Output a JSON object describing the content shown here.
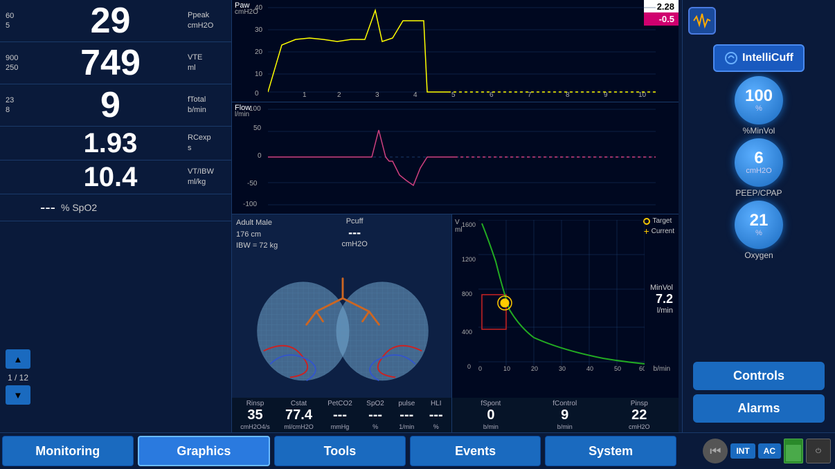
{
  "vitals": [
    {
      "id": "ppeak",
      "limits_high": "60",
      "limits_low": "5",
      "value": "29",
      "unit_line1": "Ppeak",
      "unit_line2": "cmH2O",
      "size": "large"
    },
    {
      "id": "vte",
      "limits_high": "900",
      "limits_low": "250",
      "value": "749",
      "unit_line1": "VTE",
      "unit_line2": "ml",
      "size": "large"
    },
    {
      "id": "ftotal",
      "limits_high": "23",
      "limits_low": "8",
      "value": "9",
      "unit_line1": "fTotal",
      "unit_line2": "b/min",
      "size": "large"
    },
    {
      "id": "rcexp",
      "limits_high": "",
      "limits_low": "",
      "value": "1.93",
      "unit_line1": "RCexp",
      "unit_line2": "s",
      "size": "medium"
    },
    {
      "id": "vtibw",
      "limits_high": "",
      "limits_low": "",
      "value": "10.4",
      "unit_line1": "VT/IBW",
      "unit_line2": "ml/kg",
      "size": "medium"
    }
  ],
  "spo2": {
    "value": "---",
    "label": "% SpO2"
  },
  "page_nav": {
    "current": "1",
    "total": "12"
  },
  "charts": {
    "paw": {
      "label": "Paw",
      "unit": "cmH2O",
      "current_value": "2.28",
      "second_value": "-0.5",
      "y_max": 40,
      "y_mid": 20,
      "y_zero": 0,
      "x_labels": [
        "1",
        "2",
        "3",
        "4",
        "5",
        "6",
        "7",
        "8",
        "9",
        "10"
      ]
    },
    "flow": {
      "label": "Flow",
      "unit": "l/min",
      "y_labels": [
        "100",
        "50",
        "0",
        "-50",
        "-100"
      ]
    }
  },
  "lung_panel": {
    "patient": "Adult Male",
    "height": "176 cm",
    "ibw": "IBW = 72 kg",
    "pcuff_label": "Pcuff",
    "pcuff_value": "---",
    "pcuff_unit": "cmH2O"
  },
  "scatter_panel": {
    "legend_target": "Target",
    "legend_current": "Current",
    "minvol_label": "MinVol",
    "minvol_value": "7.2",
    "minvol_unit": "l/min",
    "y_label": "V\nml",
    "y_ticks": [
      "1600",
      "1200",
      "800",
      "400",
      "0"
    ],
    "x_label": "b/min",
    "x_ticks": [
      "0",
      "10",
      "20",
      "30",
      "40",
      "50",
      "60"
    ],
    "stats": [
      {
        "label": "fSpont",
        "value": "0",
        "unit": "b/min"
      },
      {
        "label": "fControl",
        "value": "9",
        "unit": "b/min"
      },
      {
        "label": "Pinsp",
        "value": "22",
        "unit": "cmH2O"
      }
    ]
  },
  "bottom_stats": [
    {
      "label": "Rinsp",
      "value": "35",
      "unit": "cmH2O4/s"
    },
    {
      "label": "Cstat",
      "value": "77.4",
      "unit": "ml/cmH2O"
    },
    {
      "label": "PetCO2",
      "value": "---",
      "unit": "mmHg"
    },
    {
      "label": "SpO2",
      "value": "---",
      "unit": "%"
    },
    {
      "label": "pulse",
      "value": "---",
      "unit": "1/min"
    },
    {
      "label": "HLI",
      "value": "---",
      "unit": "%"
    }
  ],
  "right_panel": {
    "intellicuff_label": "IntelliCuff",
    "indicators": [
      {
        "id": "minvol",
        "value": "100",
        "unit": "%",
        "label": "%MinVol"
      },
      {
        "id": "peep",
        "value": "6",
        "unit": "cmH2O",
        "label": "PEEP/CPAP"
      },
      {
        "id": "oxygen",
        "value": "21",
        "unit": "%",
        "label": "Oxygen"
      }
    ],
    "controls_label": "Controls",
    "alarms_label": "Alarms"
  },
  "bottom_nav": {
    "tabs": [
      {
        "id": "monitoring",
        "label": "Monitoring",
        "active": false
      },
      {
        "id": "graphics",
        "label": "Graphics",
        "active": true
      },
      {
        "id": "tools",
        "label": "Tools",
        "active": false
      },
      {
        "id": "events",
        "label": "Events",
        "active": false
      },
      {
        "id": "system",
        "label": "System",
        "active": false
      }
    ]
  },
  "bottom_right": {
    "mode_int": "INT",
    "mode_ac": "AC"
  }
}
